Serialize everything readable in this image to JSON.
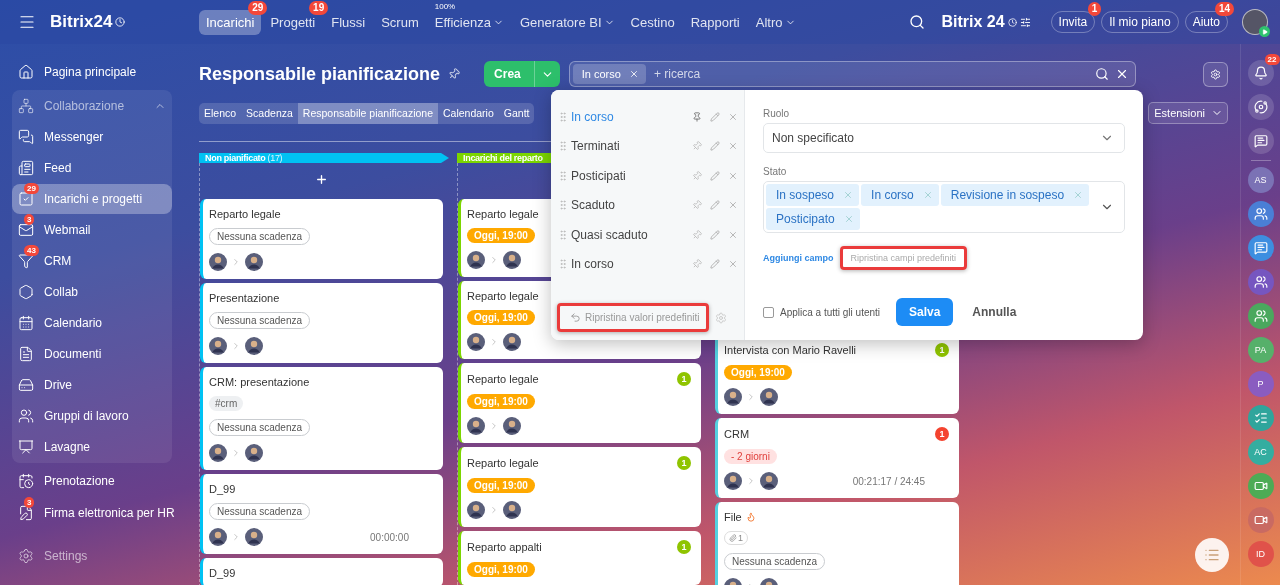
{
  "topbar": {
    "logo": "Bitrix24",
    "nav": [
      {
        "label": "Incarichi",
        "badge": "29",
        "selected": true,
        "dropdown": false
      },
      {
        "label": "Progetti",
        "badge": "19",
        "selected": false,
        "dropdown": false
      },
      {
        "label": "Flussi",
        "selected": false,
        "dropdown": false
      },
      {
        "label": "Scrum",
        "selected": false,
        "dropdown": false
      },
      {
        "label": "Efficienza",
        "note": "100%",
        "selected": false,
        "dropdown": true
      },
      {
        "label": "Generatore BI",
        "selected": false,
        "dropdown": true
      },
      {
        "label": "Cestino",
        "selected": false,
        "dropdown": false
      },
      {
        "label": "Rapporti",
        "selected": false,
        "dropdown": false
      },
      {
        "label": "Altro",
        "selected": false,
        "dropdown": true
      }
    ],
    "brand": "Bitrix 24",
    "buttons": [
      {
        "label": "Invita",
        "badge": "1"
      },
      {
        "label": "Il mio piano"
      },
      {
        "label": "Aiuto",
        "badge": "14"
      }
    ]
  },
  "sidebar": {
    "items": [
      {
        "label": "Pagina principale",
        "kind": "item",
        "selected": false
      },
      {
        "label": "Collaborazione",
        "kind": "group",
        "expanded": true,
        "children": [
          {
            "label": "Messenger",
            "selected": false
          },
          {
            "label": "Feed",
            "selected": false
          },
          {
            "label": "Incarichi e progetti",
            "badge": "29",
            "selected": true
          },
          {
            "label": "Webmail",
            "badge": "3",
            "selected": false
          },
          {
            "label": "CRM",
            "badge": "43",
            "selected": false
          },
          {
            "label": "Collab",
            "selected": false
          },
          {
            "label": "Calendario",
            "selected": false
          },
          {
            "label": "Documenti",
            "selected": false
          },
          {
            "label": "Drive",
            "selected": false
          },
          {
            "label": "Gruppi di lavoro",
            "selected": false
          },
          {
            "label": "Lavagne",
            "selected": false
          }
        ]
      },
      {
        "label": "Prenotazione",
        "kind": "item",
        "selected": false
      },
      {
        "label": "Firma elettronica per HR",
        "kind": "item",
        "badge": "3",
        "selected": false
      }
    ],
    "settings": "Settings"
  },
  "header": {
    "title": "Responsabile pianificazione",
    "create": "Crea",
    "search": {
      "chips": [
        "In corso"
      ],
      "placeholder": "+ ricerca"
    }
  },
  "view_tabs": [
    {
      "label": "Elenco",
      "selected": false
    },
    {
      "label": "Scadenza",
      "selected": false
    },
    {
      "label": "Responsabile pianificazione",
      "selected": true
    },
    {
      "label": "Calendario",
      "selected": false
    },
    {
      "label": "Gantt",
      "selected": false
    }
  ],
  "extensions": "Estensioni",
  "columns": [
    {
      "title": "Non pianificato",
      "count": "(17)",
      "color": "#00c2f3",
      "cards": [
        {
          "title": "Reparto legale",
          "deadline": {
            "text": "Nessuna scadenza",
            "kind": "none"
          },
          "avatars": true
        },
        {
          "title": "Presentazione",
          "deadline": {
            "text": "Nessuna scadenza",
            "kind": "none"
          },
          "avatars": true
        },
        {
          "title": "CRM: presentazione",
          "tags": [
            "#crm"
          ],
          "deadline": {
            "text": "Nessuna scadenza",
            "kind": "none"
          },
          "avatars": true
        },
        {
          "title": "D_99",
          "deadline": {
            "text": "Nessuna scadenza",
            "kind": "none"
          },
          "avatars": true,
          "time": "00:00:00"
        },
        {
          "title": "D_99"
        }
      ]
    },
    {
      "title": "Incarichi del reparto",
      "color": "#7bd500",
      "cards": [
        {
          "title": "Reparto legale",
          "deadline": {
            "text": "Oggi, 19:00",
            "kind": "today"
          },
          "avatars": true
        },
        {
          "title": "Reparto legale",
          "deadline": {
            "text": "Oggi, 19:00",
            "kind": "today"
          },
          "avatars": true
        },
        {
          "title": "Reparto legale",
          "counter": {
            "value": "1",
            "color": "#8fc400"
          },
          "deadline": {
            "text": "Oggi, 19:00",
            "kind": "today"
          },
          "avatars": true
        },
        {
          "title": "Reparto legale",
          "counter": {
            "value": "1",
            "color": "#8fc400"
          },
          "deadline": {
            "text": "Oggi, 19:00",
            "kind": "today"
          },
          "avatars": true
        },
        {
          "title": "Reparto appalti",
          "counter": {
            "value": "1",
            "color": "#8fc400"
          },
          "deadline": {
            "text": "Oggi, 19:00",
            "kind": "today"
          }
        }
      ]
    },
    {
      "color": "#55d0e0",
      "cards": [
        {
          "title": "Intervista con Mario Ravelli",
          "counter": {
            "value": "1",
            "color": "#8fc400"
          },
          "deadline": {
            "text": "Oggi, 19:00",
            "kind": "today"
          },
          "avatars": true
        },
        {
          "title": "CRM",
          "counter": {
            "value": "1",
            "color": "#f4432f"
          },
          "deadline": {
            "text": "- 2 giorni",
            "kind": "overdue"
          },
          "avatars": true,
          "time": "00:21:17 / 24:45"
        },
        {
          "title": "File",
          "fire": true,
          "files": "1",
          "deadline": {
            "text": "Nessuna scadenza",
            "kind": "none"
          },
          "avatars": true
        }
      ]
    }
  ],
  "popup": {
    "presets": [
      {
        "label": "In corso",
        "selected": true,
        "pinned": true
      },
      {
        "label": "Terminati",
        "selected": false,
        "pinned": false
      },
      {
        "label": "Posticipati",
        "selected": false,
        "pinned": false
      },
      {
        "label": "Scaduto",
        "selected": false,
        "pinned": false
      },
      {
        "label": "Quasi scaduto",
        "selected": false,
        "pinned": false
      },
      {
        "label": "In corso",
        "selected": false,
        "pinned": false
      }
    ],
    "reset_presets": {
      "label": "Ripristina valori predefiniti",
      "highlighted": true
    },
    "fields": [
      {
        "label": "Ruolo",
        "kind": "select",
        "value": "Non specificato"
      },
      {
        "label": "Stato",
        "kind": "multi",
        "chips": [
          "In sospeso",
          "In corso",
          "Revisione in sospeso",
          "Posticipato"
        ]
      }
    ],
    "add_field": "Aggiungi campo",
    "reset_fields": {
      "label": "Ripristina campi predefiniti",
      "highlighted": true
    },
    "apply_all": {
      "label": "Applica a tutti gli utenti",
      "checked": false
    },
    "save": "Salva",
    "cancel": "Annulla"
  },
  "rightbar": [
    {
      "kind": "bell",
      "badge": "22"
    },
    {
      "kind": "orbit"
    },
    {
      "kind": "chat"
    },
    {
      "kind": "avatar",
      "initials": "AS",
      "color": "#7b72b5"
    },
    {
      "kind": "group",
      "color": "#4a7fd6"
    },
    {
      "kind": "chat",
      "color": "#3d8ee0"
    },
    {
      "kind": "group",
      "color": "#7656c0"
    },
    {
      "kind": "group",
      "color": "#4aa85e"
    },
    {
      "kind": "avatar",
      "initials": "PA",
      "color": "#56b06a"
    },
    {
      "kind": "avatar",
      "initials": "P",
      "color": "#8a5cc0"
    },
    {
      "kind": "task",
      "color": "#2fa59c"
    },
    {
      "kind": "avatar",
      "initials": "AC",
      "color": "#34ada0"
    },
    {
      "kind": "video",
      "color": "#4dab55"
    },
    {
      "kind": "video",
      "color": "#c96a62"
    },
    {
      "kind": "avatar",
      "initials": "ID",
      "color": "#e0524a"
    }
  ]
}
